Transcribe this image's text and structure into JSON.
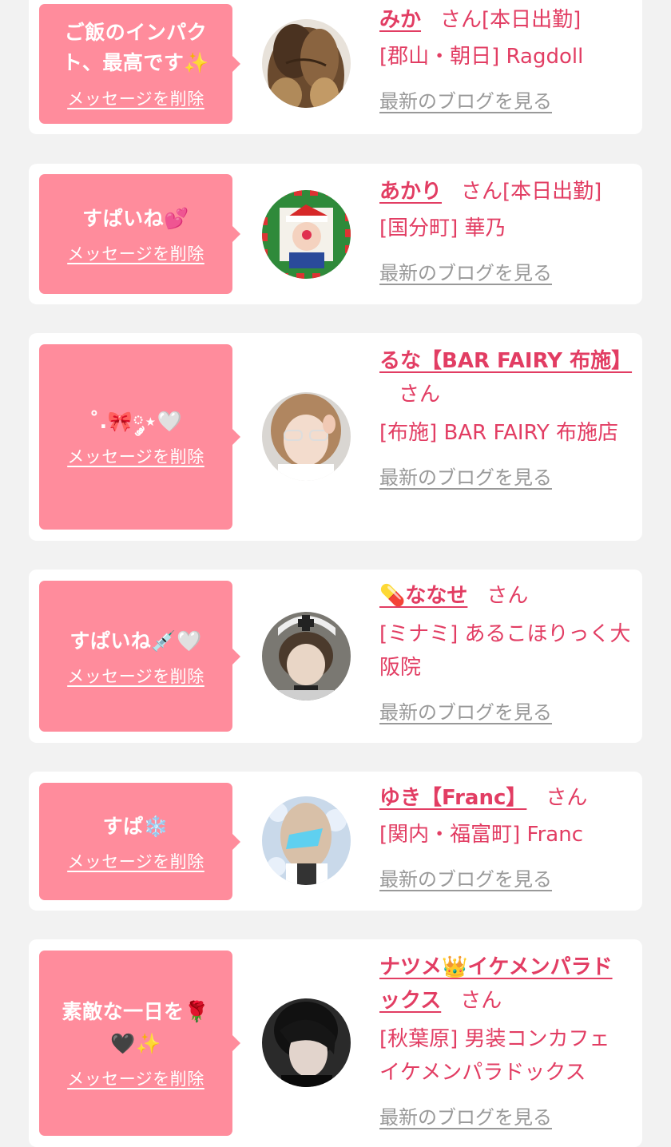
{
  "cards": [
    {
      "message": "ご飯のインパクト、最高です✨",
      "delete_label": "メッセージを削除",
      "name": "みか",
      "honorific": "さん",
      "status": "[本日出勤]",
      "shop": "[郡山・朝日] Ragdoll",
      "blog_label": "最新のブログを見る"
    },
    {
      "message": "すぱいね💕",
      "delete_label": "メッセージを削除",
      "name": "あかり",
      "honorific": "さん",
      "status": "[本日出勤]",
      "shop": "[国分町] 華乃",
      "blog_label": "最新のブログを見る"
    },
    {
      "message": "˚.🎀༘⋆🤍",
      "delete_label": "メッセージを削除",
      "name": "るな【BAR FAIRY 布施】",
      "honorific": "さん",
      "shop": "[布施] BAR FAIRY 布施店",
      "blog_label": "最新のブログを見る"
    },
    {
      "message": "すぱいね💉🤍",
      "delete_label": "メッセージを削除",
      "name": "💊ななせ",
      "honorific": "さん",
      "shop": "[ミナミ] あるこほりっく大阪院",
      "blog_label": "最新のブログを見る"
    },
    {
      "message": "すぱ❄️",
      "delete_label": "メッセージを削除",
      "name": "ゆき【Franc】",
      "honorific": "さん",
      "shop": "[関内・福富町] Franc",
      "blog_label": "最新のブログを見る"
    },
    {
      "message": "素敵な一日を🌹🖤✨",
      "delete_label": "メッセージを削除",
      "name": "ナツメ👑イケメンパラドックス",
      "honorific": "さん",
      "shop": "[秋葉原] 男装コンカフェ イケメンパラドックス",
      "blog_label": "最新のブログを見る"
    }
  ],
  "colors": {
    "page_background": "#f2f2f2",
    "card_background": "#ffffff",
    "bubble_background": "#ff8c9c",
    "accent_text": "#e23d63",
    "blog_link": "#999999"
  }
}
